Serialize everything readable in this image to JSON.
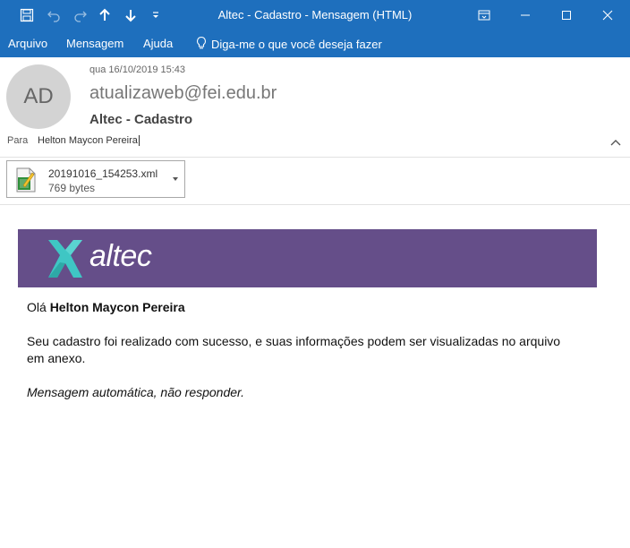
{
  "window": {
    "title": "Altec - Cadastro  -  Mensagem (HTML)"
  },
  "menu": {
    "items": [
      "Arquivo",
      "Mensagem",
      "Ajuda"
    ],
    "tell_me": "Diga-me o que você deseja fazer"
  },
  "message": {
    "avatar_initials": "AD",
    "date": "qua 16/10/2019 15:43",
    "sender": "atualizaweb@fei.edu.br",
    "subject": "Altec - Cadastro",
    "to_label": "Para",
    "to_value": "Helton Maycon Pereira"
  },
  "attachment": {
    "filename": "20191016_154253.xml",
    "size": "769 bytes"
  },
  "body": {
    "banner_logo_text": "altec",
    "greeting_prefix": "Olá",
    "greeting_name": "Helton Maycon Pereira",
    "paragraph": "Seu cadastro foi realizado com sucesso, e suas informações podem ser visualizadas no arquivo em anexo.",
    "auto_note": "Mensagem automática, não responder."
  },
  "colors": {
    "titlebar": "#1e6fbd",
    "banner": "#654e89",
    "logo_teal": "#3fc6c4"
  }
}
